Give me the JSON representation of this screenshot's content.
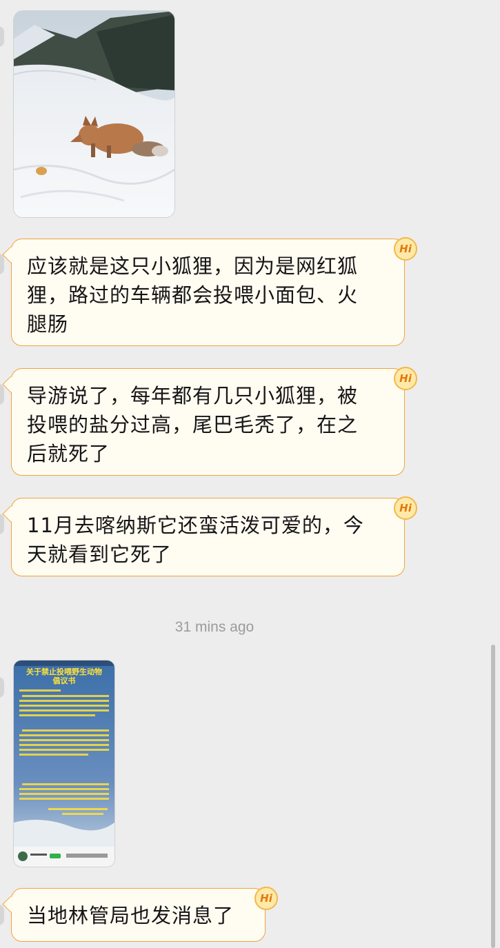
{
  "messages": [
    {
      "type": "image",
      "description": "fox-in-snow-photo"
    },
    {
      "type": "text",
      "text": "应该就是这只小狐狸，因为是网红狐狸，路过的车辆都会投喂小面包、火腿肠",
      "badge": "Hi"
    },
    {
      "type": "text",
      "text": "导游说了，每年都有几只小狐狸，被投喂的盐分过高，尾巴毛秃了，在之后就死了",
      "badge": "Hi"
    },
    {
      "type": "text",
      "text": "11月去喀纳斯它还蛮活泼可爱的，今天就看到它死了",
      "badge": "Hi"
    },
    {
      "type": "timestamp",
      "text": "31 mins ago"
    },
    {
      "type": "image",
      "description": "notice-screenshot",
      "notice_title_line1": "关于禁止投喂野生动物",
      "notice_title_line2": "倡议书"
    },
    {
      "type": "text",
      "text": "当地林管局也发消息了",
      "badge": "Hi"
    }
  ],
  "bubble_line_breaks": {
    "m1": [
      "应该就是这只小狐狸，因为是网红狐",
      "狸，路过的车辆都会投喂小面包、火",
      "腿肠"
    ],
    "m2": [
      "导游说了，每年都有几只小狐狸，被",
      "投喂的盐分过高，尾巴毛秃了，在之",
      "后就死了"
    ],
    "m3": [
      "11月去喀纳斯它还蛮活泼可爱的，今",
      "天就看到它死了"
    ],
    "m4": [
      "当地林管局也发消息了"
    ]
  },
  "colors": {
    "bubble_border": "#f0a33a",
    "bubble_bg": "#fffcf2",
    "badge_text": "#e07a10",
    "background": "#ededed"
  }
}
